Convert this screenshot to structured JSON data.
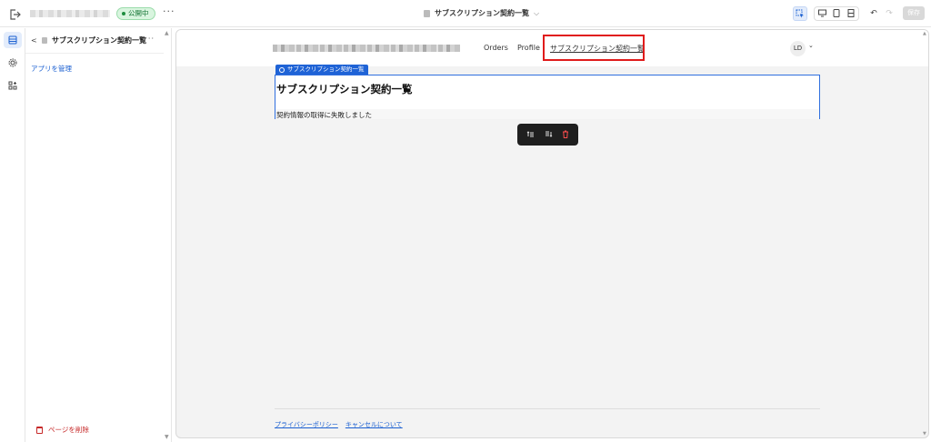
{
  "topbar": {
    "status_badge": "公開中",
    "more_label": "···",
    "page_title": "サブスクリプション契約一覧",
    "save_label": "保存"
  },
  "sidebar": {
    "back_label": "<",
    "page_name": "サブスクリプション契約一覧",
    "more_label": "···",
    "manage_apps": "アプリを管理",
    "delete_page": "ページを削除"
  },
  "site": {
    "nav": {
      "orders": "Orders",
      "profile": "Profile",
      "subscriptions": "サブスクリプション契約一覧"
    },
    "avatar_initials": "LD"
  },
  "component": {
    "tag_label": "サブスクリプション契約一覧",
    "heading": "サブスクリプション契約一覧",
    "error_message": "契約情報の取得に失敗しました"
  },
  "footer": {
    "privacy": "プライバシーポリシー",
    "cancellation": "キャンセルについて"
  },
  "colors": {
    "accent": "#1f63d6",
    "highlight": "#e01b1b",
    "published": "#1e8e3e",
    "danger": "#c62828"
  }
}
